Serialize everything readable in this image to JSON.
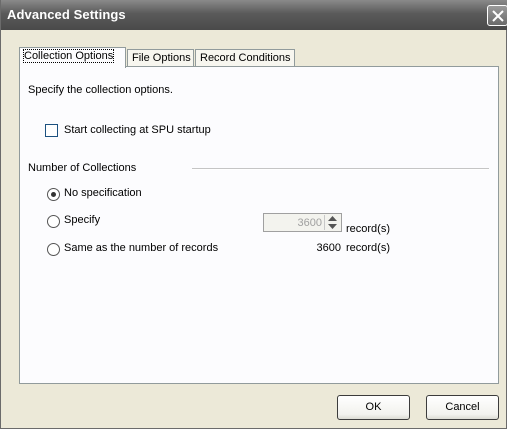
{
  "window": {
    "title": "Advanced Settings"
  },
  "tabs": [
    {
      "label": "Collection Options"
    },
    {
      "label": "File Options"
    },
    {
      "label": "Record Conditions"
    }
  ],
  "collection": {
    "description": "Specify the collection options.",
    "start_checkbox_label": "Start collecting at SPU startup",
    "start_checked": false,
    "group_label": "Number of Collections",
    "options": [
      {
        "label": "No specification",
        "checked": true
      },
      {
        "label": "Specify",
        "checked": false
      },
      {
        "label": "Same as the number of records",
        "checked": false
      }
    ],
    "specify_value": "3600",
    "specify_unit": "record(s)",
    "same_value": "3600",
    "same_unit": "record(s)"
  },
  "buttons": {
    "ok": "OK",
    "cancel": "Cancel"
  },
  "icons": {
    "close": "close-icon",
    "spin_up": "arrow-up-icon",
    "spin_down": "arrow-down-icon"
  }
}
